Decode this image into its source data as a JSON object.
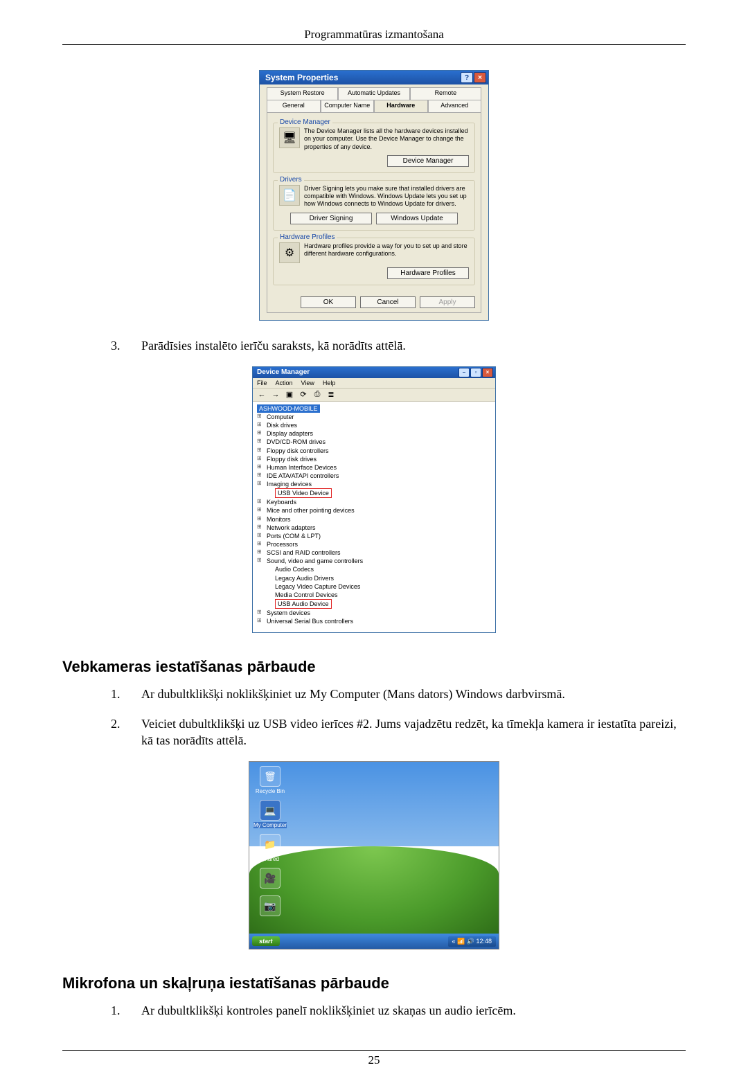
{
  "page": {
    "header": "Programmatūras izmantošana",
    "number": "25"
  },
  "sys_props": {
    "title": "System Properties",
    "btn_help": "?",
    "btn_close": "×",
    "tabs_row1": [
      "System Restore",
      "Automatic Updates",
      "Remote"
    ],
    "tabs_row2": [
      "General",
      "Computer Name",
      "Hardware",
      "Advanced"
    ],
    "active_tab": "Hardware",
    "dev_mgr": {
      "legend": "Device Manager",
      "desc": "The Device Manager lists all the hardware devices installed on your computer. Use the Device Manager to change the properties of any device.",
      "btn": "Device Manager"
    },
    "drivers": {
      "legend": "Drivers",
      "desc": "Driver Signing lets you make sure that installed drivers are compatible with Windows. Windows Update lets you set up how Windows connects to Windows Update for drivers.",
      "btn1": "Driver Signing",
      "btn2": "Windows Update"
    },
    "hw_profiles": {
      "legend": "Hardware Profiles",
      "desc": "Hardware profiles provide a way for you to set up and store different hardware configurations.",
      "btn": "Hardware Profiles"
    },
    "footer": {
      "ok": "OK",
      "cancel": "Cancel",
      "apply": "Apply"
    }
  },
  "list_after_sysprops": {
    "num": "3.",
    "text": "Parādīsies instalēto ierīču saraksts, kā norādīts attēlā."
  },
  "dev_mgr_window": {
    "title": "Device Manager",
    "menu": [
      "File",
      "Action",
      "View",
      "Help"
    ],
    "toolbar": [
      "←",
      "→",
      "▣",
      "⟳",
      "⎙",
      "≣"
    ],
    "root": "ASHWOOD-MOBILE",
    "nodes": [
      "Computer",
      "Disk drives",
      "Display adapters",
      "DVD/CD-ROM drives",
      "Floppy disk controllers",
      "Floppy disk drives",
      "Human Interface Devices",
      "IDE ATA/ATAPI controllers",
      "Imaging devices"
    ],
    "hl_usb_video": "USB Video Device",
    "nodes2": [
      "Keyboards",
      "Mice and other pointing devices",
      "Monitors",
      "Network adapters",
      "Ports (COM & LPT)",
      "Processors",
      "SCSI and RAID controllers",
      "Sound, video and game controllers"
    ],
    "sound_children": [
      "Audio Codecs",
      "Legacy Audio Drivers",
      "Legacy Video Capture Devices",
      "Media Control Devices"
    ],
    "hl_usb_audio": "USB Audio Device",
    "nodes3": [
      "System devices",
      "Universal Serial Bus controllers"
    ]
  },
  "section_webcam": "Vebkameras iestatīšanas pārbaude",
  "webcam_steps": {
    "s1_num": "1.",
    "s1_text": "Ar dubultklikšķi noklikšķiniet uz My Computer (Mans dators) Windows darbvirsmā.",
    "s2_num": "2.",
    "s2_text": "Veiciet dubultklikšķi uz USB video ierīces #2. Jums vajadzētu redzēt, ka tīmekļa kamera ir iestatīta pareizi, kā tas norādīts attēlā."
  },
  "xp_desktop": {
    "icons": [
      {
        "glyph": "🗑",
        "label": "Recycle Bin"
      },
      {
        "glyph": "💻",
        "label": "My Computer"
      },
      {
        "glyph": "📁",
        "label": "Shared"
      },
      {
        "glyph": "🎥",
        "label": ""
      },
      {
        "glyph": "📷",
        "label": ""
      }
    ],
    "start": "start",
    "tray": "« 📶 🔊 12:48"
  },
  "section_mic": "Mikrofona un skaļruņa iestatīšanas pārbaude",
  "mic_steps": {
    "s1_num": "1.",
    "s1_text": "Ar dubultklikšķi kontroles panelī noklikšķiniet uz skaņas un audio ierīcēm."
  }
}
